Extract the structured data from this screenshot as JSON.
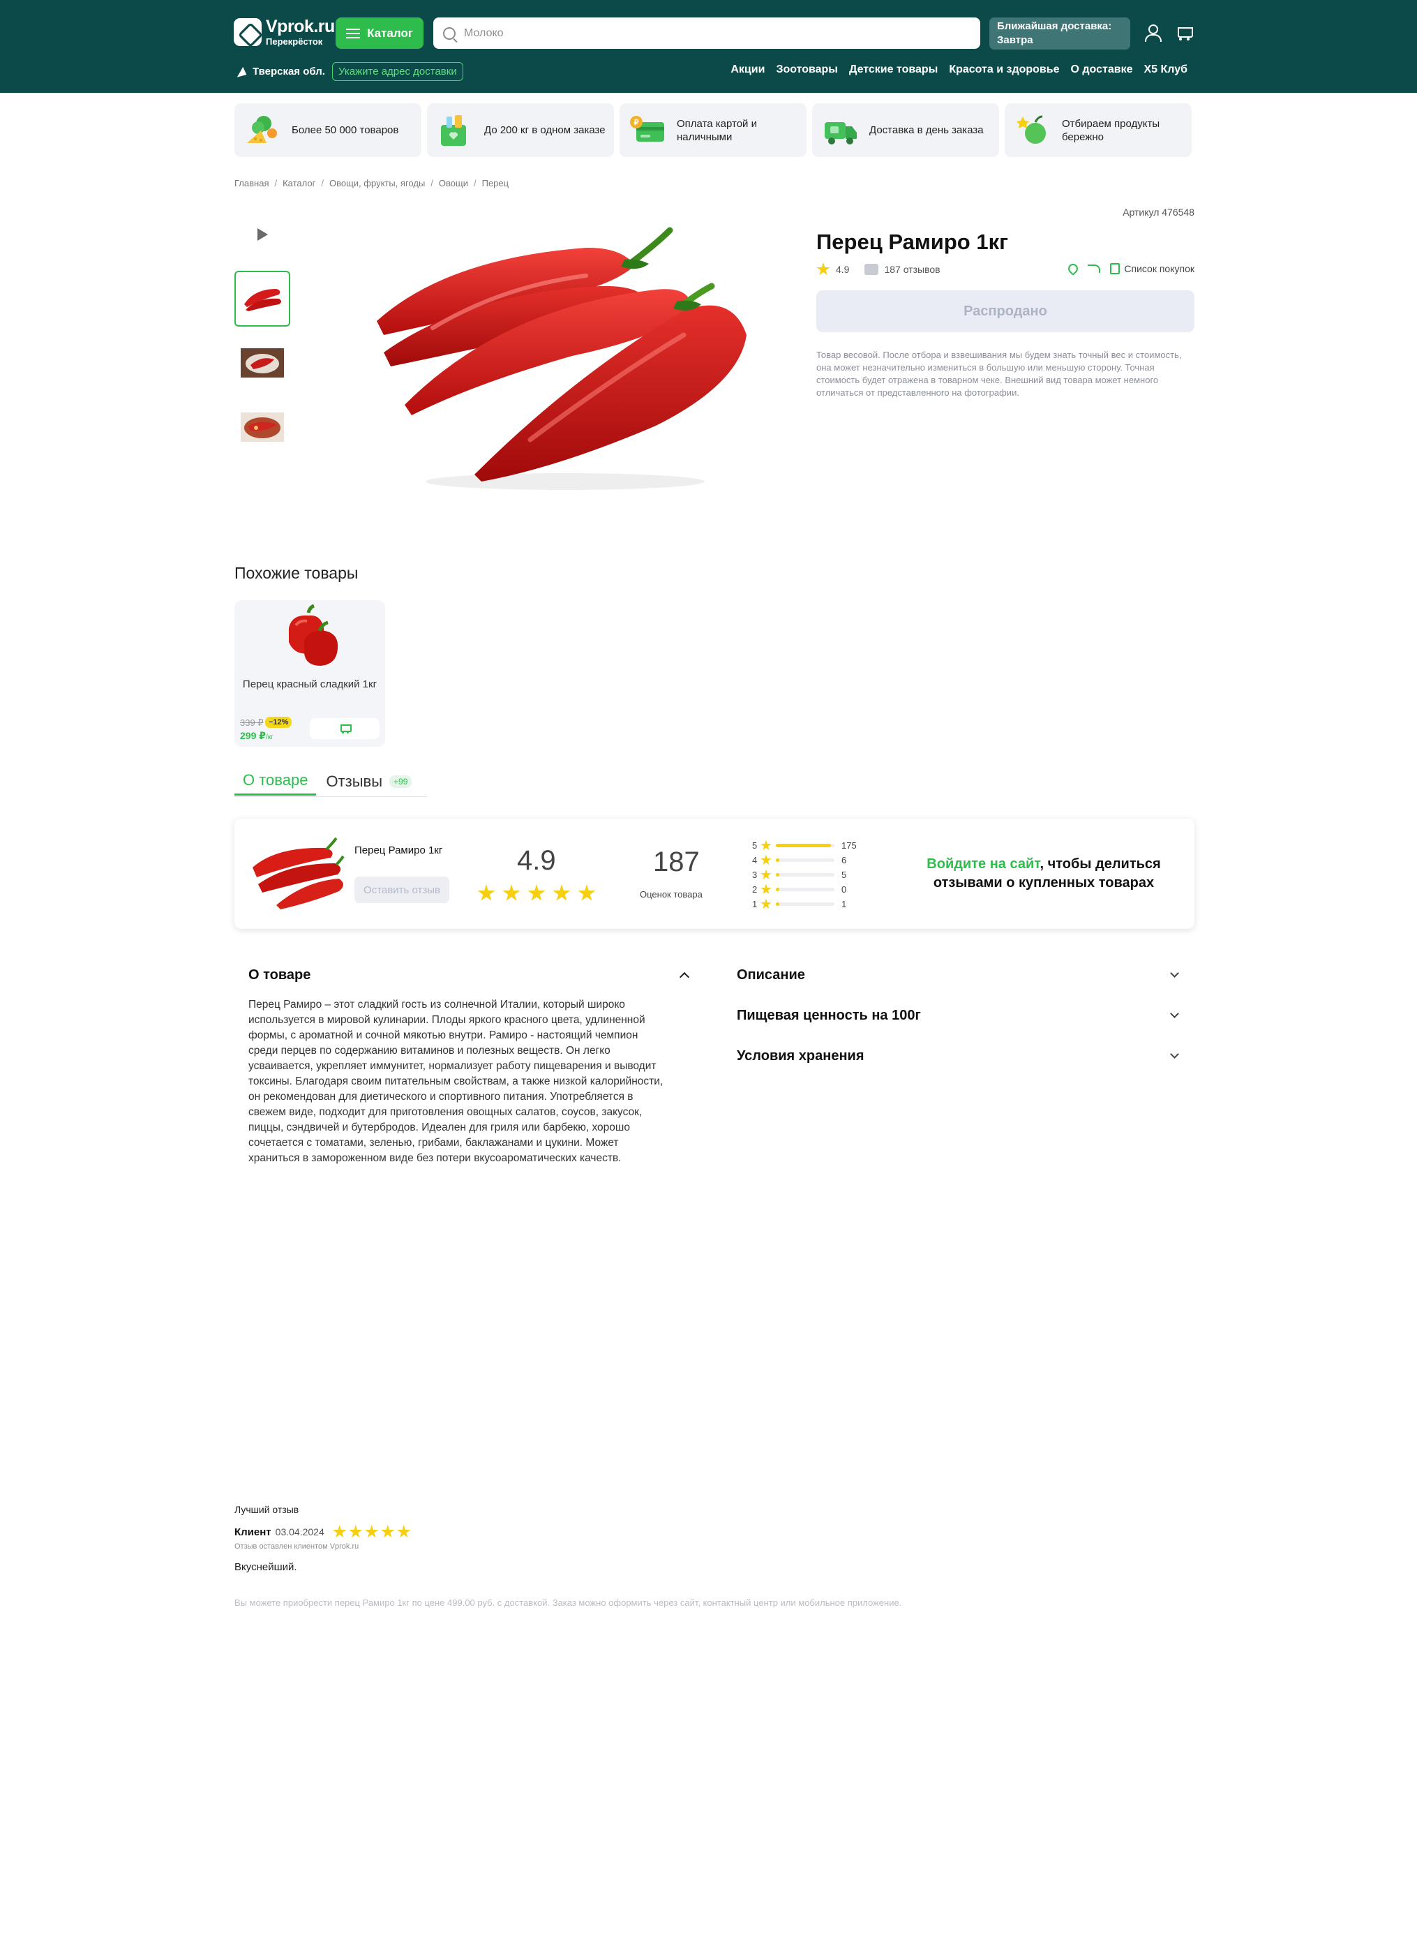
{
  "header": {
    "logo_title": "Vprok.ru",
    "logo_subtitle": "Перекрёсток",
    "catalog_label": "Каталог",
    "search_placeholder": "Молоко",
    "delivery_line1": "Ближайшая доставка:",
    "delivery_line2": "Завтра",
    "region": "Тверская обл.",
    "address_button": "Укажите адрес доставки",
    "nav": [
      "Акции",
      "Зоотовары",
      "Детские товары",
      "Красота и здоровье",
      "О доставке",
      "X5 Клуб"
    ],
    "colors": {
      "bar": "#0c4a4a",
      "accent": "#2ebd4d"
    }
  },
  "benefits": [
    {
      "icon": "vegetables-icon",
      "text": "Более 50 000 товаров"
    },
    {
      "icon": "grocery-bag-icon",
      "text": "До 200 кг в одном заказе"
    },
    {
      "icon": "payment-card-icon",
      "text": "Оплата картой и наличными"
    },
    {
      "icon": "delivery-truck-icon",
      "text": "Доставка в день заказа"
    },
    {
      "icon": "apple-icon",
      "text": "Отбираем продукты бережно"
    }
  ],
  "breadcrumbs": [
    "Главная",
    "Каталог",
    "Овощи, фрукты, ягоды",
    "Овощи",
    "Перец"
  ],
  "product": {
    "sku": "Артикул 476548",
    "title": "Перец Рамиро 1кг",
    "rating": "4.9",
    "reviews_count_text": "187 отзывов",
    "shopping_list_label": "Список покупок",
    "sold_out_label": "Распродано",
    "weight_note": "Товар весовой. После отбора и взвешивания мы будем знать точный вес и стоимость, она может незначительно измениться в большую или меньшую сторону. Точная стоимость будет отражена в товарном чеке. Внешний вид товара может немного отличаться от представленного на фотографии."
  },
  "similar": {
    "title": "Похожие товары",
    "items": [
      {
        "name": "Перец красный сладкий 1кг",
        "old_price": "339 ₽",
        "discount": "−12%",
        "price": "299 ₽",
        "unit": "/кг"
      }
    ]
  },
  "tabs": {
    "about": "О товаре",
    "reviews": "Отзывы",
    "reviews_badge": "+99"
  },
  "review_summary": {
    "product_name": "Перец Рамиро 1кг",
    "leave_review_label": "Оставить отзыв",
    "score": "4.9",
    "stars_filled": 5,
    "total": "187",
    "total_label": "Оценок товара",
    "distribution": [
      {
        "stars": "5",
        "count": "175",
        "fraction": 0.935
      },
      {
        "stars": "4",
        "count": "6",
        "fraction": 0.032
      },
      {
        "stars": "3",
        "count": "5",
        "fraction": 0.027
      },
      {
        "stars": "2",
        "count": "0",
        "fraction": 0.0
      },
      {
        "stars": "1",
        "count": "1",
        "fraction": 0.005
      }
    ],
    "login_link": "Войдите на сайт",
    "login_text": ", чтобы делиться отзывами о купленных товарах",
    "star_color": "#f6cf10"
  },
  "about": {
    "heading": "О товаре",
    "text": "Перец Рамиро – этот сладкий гость из солнечной Италии, который широко используется в мировой кулинарии. Плоды яркого красного цвета, удлиненной формы, с ароматной и сочной мякотью внутри. Рамиро - настоящий чемпион среди перцев по содержанию витаминов и полезных веществ. Он легко усваивается, укрепляет иммунитет, нормализует работу пищеварения и выводит токсины. Благодаря своим питательным свойствам, а также низкой калорийности, он рекомендован для диетического и спортивного питания. Употребляется в свежем виде, подходит для приготовления овощных салатов, соусов, закусок, пиццы, сэндвичей и бутербродов. Идеален для гриля или барбекю, хорошо сочетается с томатами, зеленью, грибами, баклажанами и цукини. Может храниться в замороженном виде без потери вкусоароматических качеств."
  },
  "accordions": [
    "Описание",
    "Пищевая ценность на 100г",
    "Условия хранения"
  ],
  "best_review": {
    "label": "Лучший отзыв",
    "author": "Клиент",
    "date": "03.04.2024",
    "stars": 5,
    "source": "Отзыв оставлен клиентом Vprok.ru",
    "text": "Вкуснейший."
  },
  "seo_text": "Вы можете приобрести перец Рамиро 1кг по цене 499.00 руб. с доставкой. Заказ можно оформить через сайт, контактный центр или мобильное приложение."
}
